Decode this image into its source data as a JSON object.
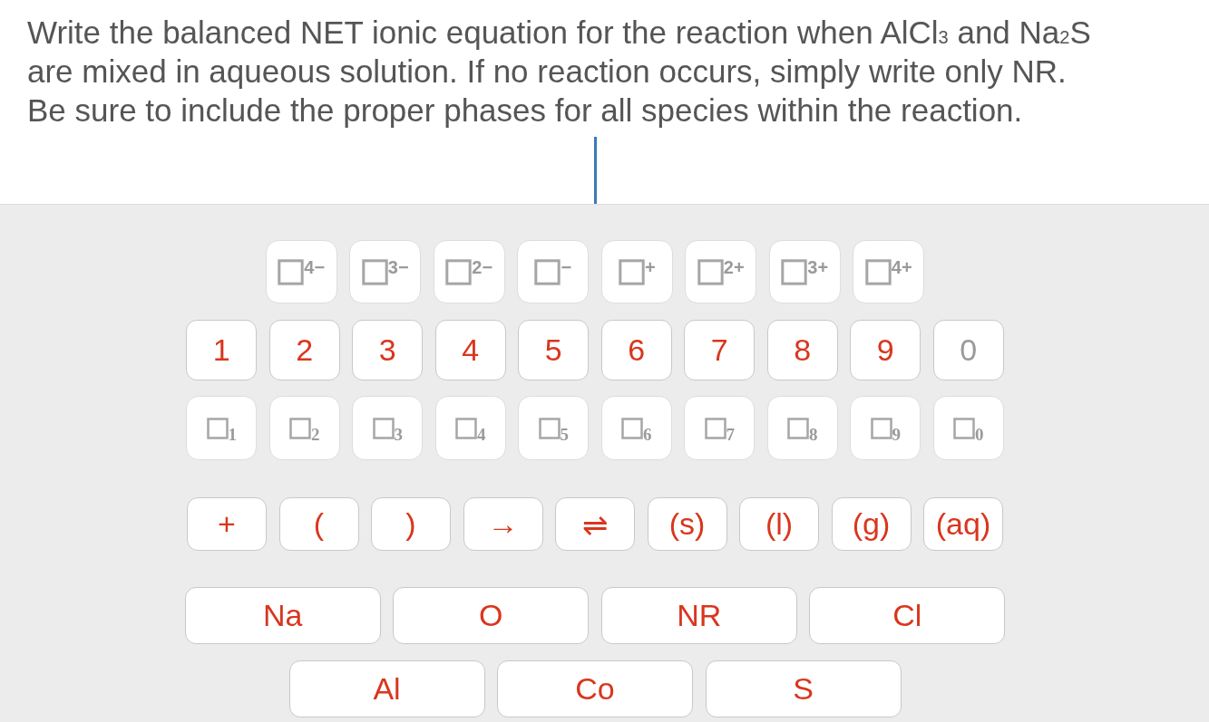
{
  "question": "Write the balanced NET ionic equation for the reaction when AlCl$_{3}$ and Na$_{2}$S are mixed in aqueous solution. If no reaction occurs, simply write only NR. Be sure to include the proper phases for all species within the reaction.",
  "answer_field": {
    "focused": true
  },
  "keypad": {
    "rows": [
      {
        "keys": [
          {
            "kind": "charge",
            "label": "4−",
            "disabled": true
          },
          {
            "kind": "charge",
            "label": "3−",
            "disabled": true
          },
          {
            "kind": "charge",
            "label": "2−",
            "disabled": true
          },
          {
            "kind": "charge",
            "label": "−",
            "disabled": true
          },
          {
            "kind": "charge",
            "label": "+",
            "disabled": true
          },
          {
            "kind": "charge",
            "label": "2+",
            "disabled": true
          },
          {
            "kind": "charge",
            "label": "3+",
            "disabled": true
          },
          {
            "kind": "charge",
            "label": "4+",
            "disabled": true
          }
        ]
      },
      {
        "keys": [
          {
            "kind": "digit",
            "label": "1",
            "disabled": false
          },
          {
            "kind": "digit",
            "label": "2",
            "disabled": false
          },
          {
            "kind": "digit",
            "label": "3",
            "disabled": false
          },
          {
            "kind": "digit",
            "label": "4",
            "disabled": false
          },
          {
            "kind": "digit",
            "label": "5",
            "disabled": false
          },
          {
            "kind": "digit",
            "label": "6",
            "disabled": false
          },
          {
            "kind": "digit",
            "label": "7",
            "disabled": false
          },
          {
            "kind": "digit",
            "label": "8",
            "disabled": false
          },
          {
            "kind": "digit",
            "label": "9",
            "disabled": false
          },
          {
            "kind": "digit",
            "label": "0",
            "disabled": true
          }
        ]
      },
      {
        "keys": [
          {
            "kind": "subscript",
            "label": "1",
            "disabled": true
          },
          {
            "kind": "subscript",
            "label": "2",
            "disabled": true
          },
          {
            "kind": "subscript",
            "label": "3",
            "disabled": true
          },
          {
            "kind": "subscript",
            "label": "4",
            "disabled": true
          },
          {
            "kind": "subscript",
            "label": "5",
            "disabled": true
          },
          {
            "kind": "subscript",
            "label": "6",
            "disabled": true
          },
          {
            "kind": "subscript",
            "label": "7",
            "disabled": true
          },
          {
            "kind": "subscript",
            "label": "8",
            "disabled": true
          },
          {
            "kind": "subscript",
            "label": "9",
            "disabled": true
          },
          {
            "kind": "subscript",
            "label": "0",
            "disabled": true
          }
        ]
      },
      {
        "keys": [
          {
            "kind": "symbol",
            "label": "+",
            "disabled": false
          },
          {
            "kind": "symbol",
            "label": "(",
            "disabled": false
          },
          {
            "kind": "symbol",
            "label": ")",
            "disabled": false
          },
          {
            "kind": "symbol",
            "label": "→",
            "disabled": false
          },
          {
            "kind": "symbol",
            "label": "⇌",
            "disabled": false
          },
          {
            "kind": "symbol",
            "label": "(s)",
            "disabled": false
          },
          {
            "kind": "symbol",
            "label": "(l)",
            "disabled": false
          },
          {
            "kind": "symbol",
            "label": "(g)",
            "disabled": false
          },
          {
            "kind": "symbol",
            "label": "(aq)",
            "disabled": false
          }
        ]
      },
      {
        "keys": [
          {
            "kind": "element",
            "label": "Na",
            "disabled": false
          },
          {
            "kind": "element",
            "label": "O",
            "disabled": false
          },
          {
            "kind": "element",
            "label": "NR",
            "disabled": false
          },
          {
            "kind": "element",
            "label": "Cl",
            "disabled": false
          }
        ]
      },
      {
        "keys": [
          {
            "kind": "element",
            "label": "Al",
            "disabled": false
          },
          {
            "kind": "element",
            "label": "Co",
            "disabled": false
          },
          {
            "kind": "element",
            "label": "S",
            "disabled": false
          }
        ]
      }
    ]
  }
}
